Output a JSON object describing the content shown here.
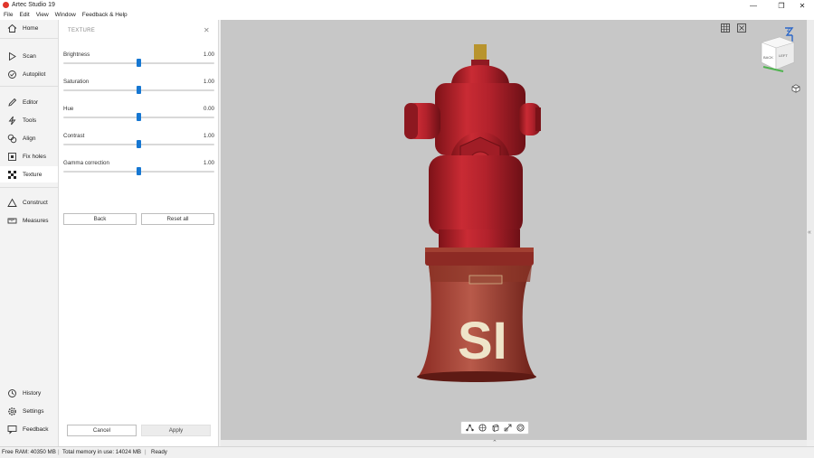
{
  "window": {
    "title": "Artec Studio 19"
  },
  "menu": [
    "File",
    "Edit",
    "View",
    "Window",
    "Feedback & Help"
  ],
  "sidebar": {
    "top": [
      {
        "label": "Home",
        "icon": "home-icon"
      },
      {
        "label": "Scan",
        "icon": "play-icon"
      },
      {
        "label": "Autopilot",
        "icon": "autopilot-icon"
      },
      {
        "label": "Editor",
        "icon": "pencil-icon"
      },
      {
        "label": "Tools",
        "icon": "lightning-icon"
      },
      {
        "label": "Align",
        "icon": "align-icon"
      },
      {
        "label": "Fix holes",
        "icon": "fix-holes-icon"
      },
      {
        "label": "Texture",
        "icon": "texture-icon"
      },
      {
        "label": "Construct",
        "icon": "triangle-icon"
      },
      {
        "label": "Measures",
        "icon": "ruler-icon"
      }
    ],
    "bottom": [
      {
        "label": "History",
        "icon": "history-icon"
      },
      {
        "label": "Settings",
        "icon": "gear-icon"
      },
      {
        "label": "Feedback",
        "icon": "chat-icon"
      }
    ],
    "active": "Texture"
  },
  "panel": {
    "header": "TEXTURE",
    "sliders": [
      {
        "label": "Brightness",
        "value": "1.00",
        "position": 0.5
      },
      {
        "label": "Saturation",
        "value": "1.00",
        "position": 0.5
      },
      {
        "label": "Hue",
        "value": "0.00",
        "position": 0.5
      },
      {
        "label": "Contrast",
        "value": "1.00",
        "position": 0.5
      },
      {
        "label": "Gamma correction",
        "value": "1.00",
        "position": 0.5
      }
    ],
    "back_label": "Back",
    "reset_label": "Reset all",
    "cancel_label": "Cancel",
    "apply_label": "Apply"
  },
  "viewcube": {
    "front": "BACK",
    "side": "LEFT",
    "axis": "Z"
  },
  "status": {
    "free_ram": "Free RAM: 40350 MB",
    "total_memory": "Total memory in use: 14024 MB",
    "state": "Ready"
  },
  "colors": {
    "accent": "#1677d2",
    "viewport": "#c7c7c7",
    "hydrant": "#b3222c"
  }
}
